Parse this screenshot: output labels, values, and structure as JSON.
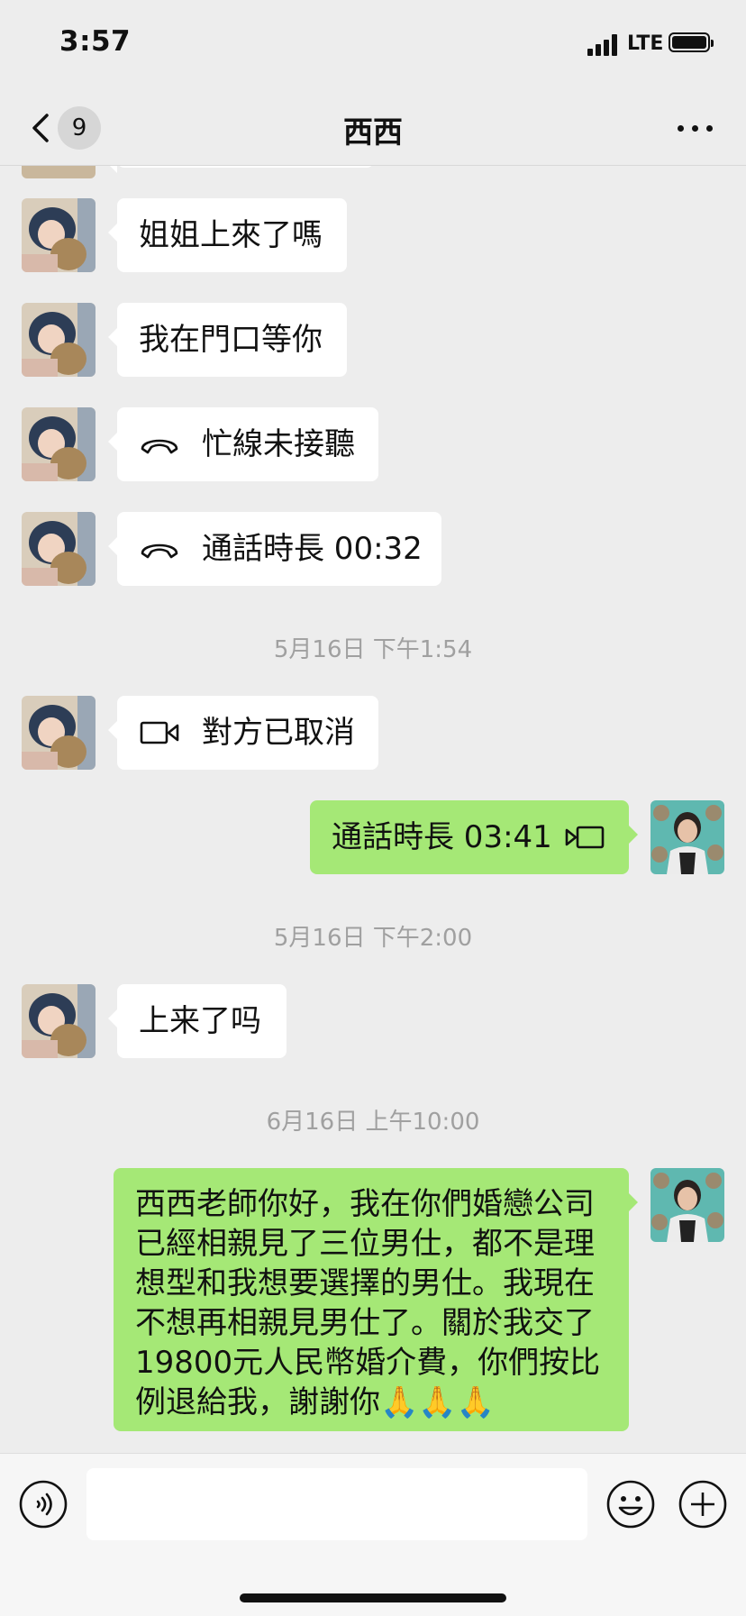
{
  "status_bar": {
    "time": "3:57",
    "network": "LTE"
  },
  "nav": {
    "unread_count": "9",
    "title": "西西"
  },
  "messages": [
    {
      "text": "姐姐上來了嗎"
    },
    {
      "text": "我在門口等你"
    },
    {
      "text": "忙線未接聽",
      "icon": "phone-hangup-icon"
    },
    {
      "text": "通話時長 00:32",
      "icon": "phone-hangup-icon"
    },
    {
      "text": "對方已取消",
      "icon": "video-call-icon"
    },
    {
      "text": "通話時長 03:41",
      "icon": "video-call-icon"
    },
    {
      "text": "上来了吗"
    },
    {
      "text": "西西老師你好，我在你們婚戀公司已經相親見了三位男仕，都不是理想型和我想要選擇的男仕。我現在不想再相親見男仕了。關於我交了19800元人民幣婚介費，你們按比例退給我，謝謝你🙏🙏🙏"
    }
  ],
  "timestamps": [
    "5月16日 下午1:54",
    "5月16日 下午2:00",
    "6月16日 上午10:00"
  ],
  "colors": {
    "outgoing_bubble": "#a5e876",
    "incoming_bubble": "#ffffff",
    "background": "#ededed"
  }
}
